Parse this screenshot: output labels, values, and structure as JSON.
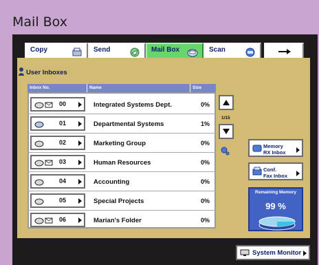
{
  "window": {
    "title": "Mail Box"
  },
  "tabs": [
    {
      "label": "Copy",
      "icon": "copy-icon",
      "active": false
    },
    {
      "label": "Send",
      "icon": "send-icon",
      "active": false
    },
    {
      "label": "Mail Box",
      "icon": "mailbox-icon",
      "active": true
    },
    {
      "label": "Scan",
      "icon": "scan-icon",
      "active": false
    },
    {
      "label": "",
      "icon": "arrow-right-icon",
      "active": false
    }
  ],
  "section": {
    "title": "User Inboxes"
  },
  "columns": {
    "inbox_no": "Inbox No.",
    "name": "Name",
    "size": "Size"
  },
  "rows": [
    {
      "number": "00",
      "name": "Integrated Systems Dept.",
      "size": "0%"
    },
    {
      "number": "01",
      "name": "Departmental Systems",
      "size": "1%"
    },
    {
      "number": "02",
      "name": "Marketing Group",
      "size": "0%"
    },
    {
      "number": "03",
      "name": "Human Resources",
      "size": "0%"
    },
    {
      "number": "04",
      "name": "Accounting",
      "size": "0%"
    },
    {
      "number": "05",
      "name": "Special Projects",
      "size": "0%"
    },
    {
      "number": "06",
      "name": "Marian's Folder",
      "size": "0%"
    }
  ],
  "pagination": {
    "indicator": "1/15"
  },
  "side_buttons": {
    "memory_rx": {
      "line1": "Memory",
      "line2": "RX Inbox"
    },
    "conf_fax": {
      "line1": "Conf.",
      "line2": "Fax Inbox"
    }
  },
  "memory": {
    "title": "Remaining Memory",
    "value": "99 %"
  },
  "system_monitor": {
    "label": "System Monitor"
  },
  "colors": {
    "background": "#c8a4cf",
    "screen": "#d2bb74",
    "active_tab": "#67d46e",
    "header": "#7885c6",
    "memory_box": "#4263c4",
    "text_dark_blue": "#0b1f6e"
  }
}
